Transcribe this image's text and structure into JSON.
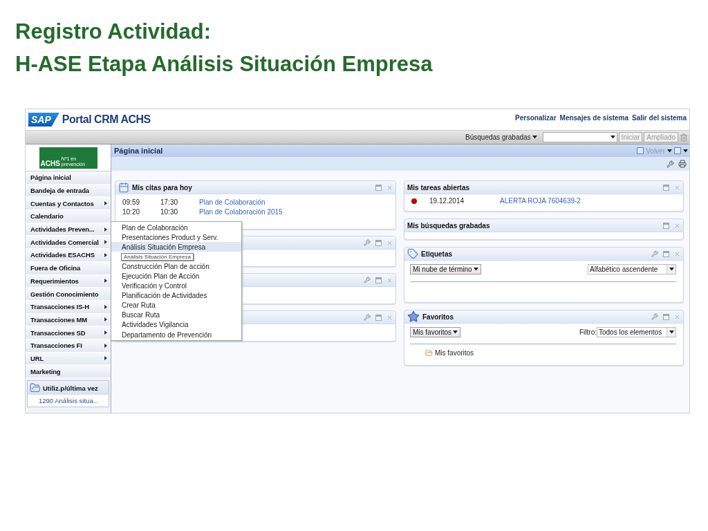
{
  "slide_title": [
    "Registro Actividad:",
    "H-ASE Etapa Análisis Situación Empresa"
  ],
  "header": {
    "brand": "SAP",
    "portal_title": "Portal CRM ACHS",
    "links": [
      "Personalizar",
      "Mensajes de sistema",
      "Salir del sistema"
    ]
  },
  "toolbar": {
    "saved_searches": "Búsquedas grabadas",
    "buttons": [
      {
        "label": "Iniciar",
        "disabled": true
      },
      {
        "label": "Ampliado",
        "disabled": true
      }
    ]
  },
  "sidebar": {
    "logo": "ACHS",
    "logo_tagline": "Nº1 en prevención",
    "items": [
      {
        "label": "Página inicial",
        "has_submenu": false
      },
      {
        "label": "Bandeja de entrada",
        "has_submenu": false
      },
      {
        "label": "Cuentas y Contactos",
        "has_submenu": true
      },
      {
        "label": "Calendario",
        "has_submenu": false
      },
      {
        "label": "Actividades Preven...",
        "has_submenu": true
      },
      {
        "label": "Actividades Comercial",
        "has_submenu": true
      },
      {
        "label": "Actividades ESACHS",
        "has_submenu": true
      },
      {
        "label": "Fuera de Oficina",
        "has_submenu": false
      },
      {
        "label": "Requerimientos",
        "has_submenu": true
      },
      {
        "label": "Gestión Conocimiento",
        "has_submenu": false
      },
      {
        "label": "Transacciones IS-H",
        "has_submenu": true
      },
      {
        "label": "Transacciones MM",
        "has_submenu": true
      },
      {
        "label": "Transacciones SD",
        "has_submenu": true
      },
      {
        "label": "Transacciones FI",
        "has_submenu": true
      },
      {
        "label": "URL",
        "has_submenu": true
      },
      {
        "label": "Marketing",
        "has_submenu": false
      }
    ],
    "recent": {
      "title": "Utiliz.p/última vez",
      "items": [
        "1290 Análisis situa..."
      ]
    }
  },
  "page": {
    "title": "Página inicial",
    "back": {
      "label": "Volver",
      "disabled": true
    }
  },
  "left_panels": [
    {
      "kind": "appointments",
      "title": "Mis citas para hoy",
      "configurable": false,
      "rows": [
        {
          "start": "09:59",
          "end": "17:30",
          "subject": "Plan de Colaboración"
        },
        {
          "start": "10:20",
          "end": "10:30",
          "subject": "Plan de Colaboración 2015"
        }
      ]
    },
    {
      "kind": "empty",
      "configurable": true
    },
    {
      "kind": "empty",
      "configurable": true
    },
    {
      "kind": "empty",
      "configurable": true
    }
  ],
  "right_panels": [
    {
      "kind": "tasks",
      "title": "Mis tareas abiertas",
      "configurable": false,
      "rows": [
        {
          "color": "#c00000",
          "date": "19.12.2014",
          "title": "ALERTA ROJA 7604639-2"
        }
      ]
    },
    {
      "kind": "empty",
      "title": "Mis búsquedas grabadas",
      "configurable": false
    },
    {
      "kind": "tags",
      "title": "Etiquetas",
      "configurable": true,
      "button": "Mi nube de término",
      "select": "Alfabético ascendente"
    },
    {
      "kind": "favorites",
      "title": "Favoritos",
      "configurable": true,
      "button": "Mis favoritos",
      "filter_label": "Filtro:",
      "select": "Todos los elementos",
      "items": [
        "Mis favoritos"
      ]
    }
  ],
  "popup_menu": {
    "items": [
      {
        "label": "Plan de Colaboración",
        "selected": false
      },
      {
        "label": "Presentaciones Product y Serv.",
        "selected": false
      },
      {
        "label": "Análisis Situación Empresa",
        "selected": true
      },
      {
        "label": "Construcción Plan de acción",
        "selected": false
      },
      {
        "label": "Ejecución Plan de Acción",
        "selected": false
      },
      {
        "label": "Verificación y Control",
        "selected": false
      },
      {
        "label": "Planificación de Actividades",
        "selected": false
      },
      {
        "label": "Crear Ruta",
        "selected": false
      },
      {
        "label": "Buscar Ruta",
        "selected": false
      },
      {
        "label": "Actividades Vigilancia",
        "selected": false
      },
      {
        "label": "Departamento de Prevención",
        "selected": false
      }
    ],
    "tooltip": "Análisis Situación Empresa"
  }
}
